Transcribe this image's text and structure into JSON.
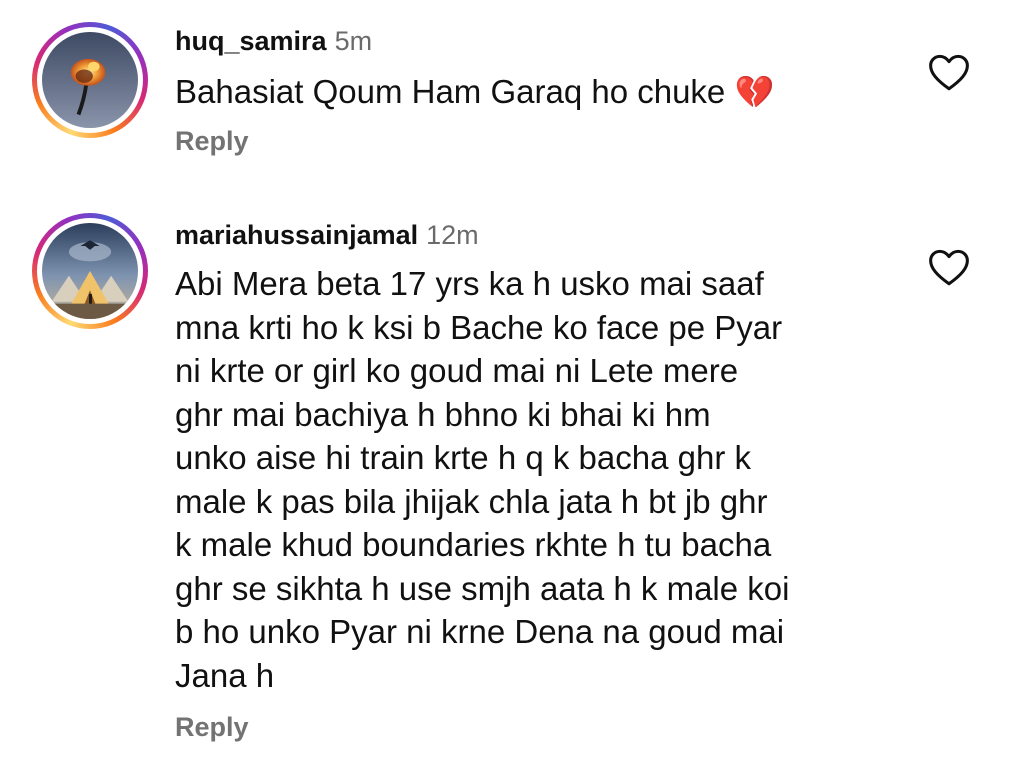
{
  "comments": [
    {
      "username": "huq_samira",
      "time": "5m",
      "text_lines": [
        "Bahasiat Qoum Ham  Garaq ho  chuke"
      ],
      "emoji": "💔",
      "reply_label": "Reply",
      "avatar_icon": "avatar-burning-rose",
      "like_icon": "heart-outline-icon"
    },
    {
      "username": "mariahussainjamal",
      "time": "12m",
      "text_lines": [
        "Abi Mera beta 17 yrs ka h usko mai saaf",
        "mna krti ho k ksi b Bache ko face pe Pyar",
        "ni krte or girl ko goud mai ni Lete mere",
        "ghr mai bachiya h bhno ki bhai ki hm",
        "unko aise hi train krte h q k bacha ghr k",
        "male k pas bila jhijak chla jata h bt jb ghr",
        "k male khud boundaries rkhte h tu bacha",
        "ghr se sikhta h use smjh aata h k male koi",
        "b ho unko Pyar ni krne Dena na goud mai",
        "Jana h"
      ],
      "reply_label": "Reply",
      "avatar_icon": "avatar-tent-camp",
      "like_icon": "heart-outline-icon"
    }
  ],
  "colors": {
    "text": "#111111",
    "muted": "#737373",
    "time": "#6b6b6b",
    "story_ring": [
      "#feda75",
      "#fa7e1e",
      "#d62976",
      "#962fbf",
      "#4f5bd5"
    ]
  }
}
